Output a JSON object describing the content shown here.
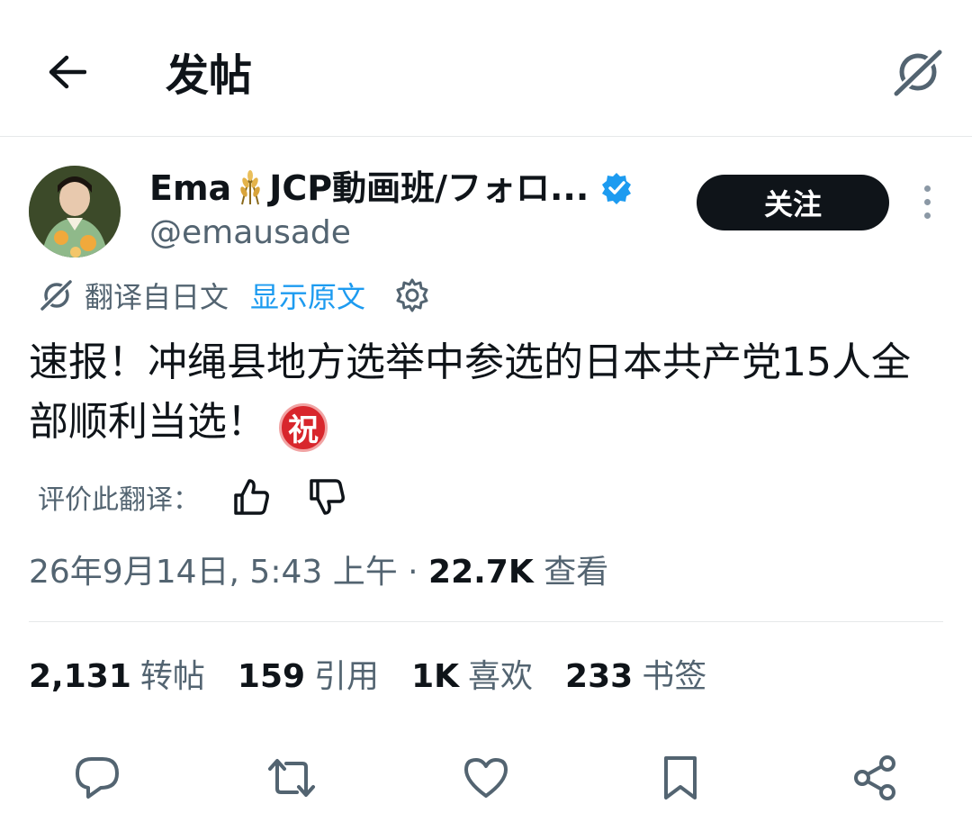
{
  "header": {
    "back_icon": "arrow-left-icon",
    "title": "发帖",
    "grok_icon": "grok-icon"
  },
  "author": {
    "name_prefix": "Ema",
    "name_suffix": "JCP動画班/フォロ...",
    "wheat_emoji": "wheat-emoji",
    "verified_icon": "verified-badge-icon",
    "handle": "@emausade",
    "follow_label": "关注",
    "more_icon": "more-vertical-icon"
  },
  "translation": {
    "icon": "grok-icon",
    "translated_from": "翻译自日文",
    "show_original": "显示原文",
    "settings_icon": "gear-icon"
  },
  "tweet": {
    "text": "速报！冲绳县地方选举中参选的日本共产党15人全部顺利当选！",
    "celebrate_emoji": "祝"
  },
  "rate": {
    "label": "评价此翻译：",
    "thumb_up_icon": "thumbs-up-icon",
    "thumb_down_icon": "thumbs-down-icon"
  },
  "meta": {
    "datetime": "26年9月14日, 5:43 上午 · ",
    "views_count": "22.7K",
    "views_label": " 查看"
  },
  "stats": [
    {
      "num": "2,131",
      "label": "转帖"
    },
    {
      "num": "159",
      "label": "引用"
    },
    {
      "num": "1K",
      "label": "喜欢"
    },
    {
      "num": "233",
      "label": "书签"
    }
  ],
  "actions": {
    "reply_icon": "reply-icon",
    "repost_icon": "repost-icon",
    "like_icon": "heart-icon",
    "bookmark_icon": "bookmark-icon",
    "share_icon": "share-icon"
  },
  "colors": {
    "text": "#0f1419",
    "secondary": "#536471",
    "accent": "#1d9bf0",
    "celebrate": "#d8262c"
  }
}
